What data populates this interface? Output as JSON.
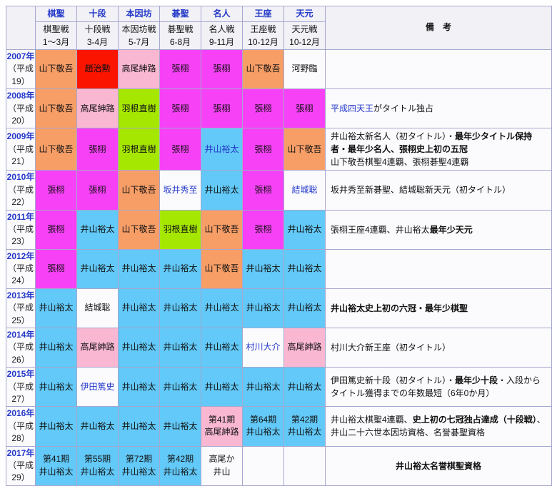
{
  "table": {
    "remarks_header": "備　考",
    "colors": {
      "orange": "#f79e67",
      "red": "#fb1500",
      "pink": "#f9b7d2",
      "magenta": "#f641f6",
      "green": "#a6e702",
      "skyblue": "#62c9f8",
      "plain": "#fbfbfe",
      "header_bg": "#f1f1f6",
      "link_blue": "#2438c8",
      "border": "#a6a7ce"
    },
    "columns": [
      {
        "key": "kisei",
        "label": "棋聖",
        "war": "棋聖戦",
        "months": "1～3月"
      },
      {
        "key": "judan",
        "label": "十段",
        "war": "十段戦",
        "months": "3-4月"
      },
      {
        "key": "honinbo",
        "label": "本因坊",
        "war": "本因坊戦",
        "months": "5-7月"
      },
      {
        "key": "gosei",
        "label": "碁聖",
        "war": "碁聖戦",
        "months": "6-8月"
      },
      {
        "key": "meijin",
        "label": "名人",
        "war": "名人戦",
        "months": "9-11月"
      },
      {
        "key": "oza",
        "label": "王座",
        "war": "王座戦",
        "months": "10-12月"
      },
      {
        "key": "tengen",
        "label": "天元",
        "war": "天元戦",
        "months": "10-12月"
      }
    ],
    "rows": [
      {
        "year": "2007年",
        "era": "（平成19）",
        "cells": [
          {
            "t": "山下敬吾",
            "c": "orange"
          },
          {
            "t": "趙治勲",
            "c": "red"
          },
          {
            "t": "高尾紳路",
            "c": "pink"
          },
          {
            "t": "張栩",
            "c": "magenta"
          },
          {
            "t": "張栩",
            "c": "magenta"
          },
          {
            "t": "山下敬吾",
            "c": "orange"
          },
          {
            "t": "河野臨",
            "c": "plain"
          }
        ],
        "remark": {
          "segments": []
        }
      },
      {
        "year": "2008年",
        "era": "（平成20）",
        "cells": [
          {
            "t": "山下敬吾",
            "c": "orange"
          },
          {
            "t": "高尾紳路",
            "c": "pink"
          },
          {
            "t": "羽根直樹",
            "c": "green"
          },
          {
            "t": "張栩",
            "c": "magenta"
          },
          {
            "t": "張栩",
            "c": "magenta"
          },
          {
            "t": "張栩",
            "c": "magenta"
          },
          {
            "t": "張栩",
            "c": "magenta"
          }
        ],
        "remark": {
          "segments": [
            {
              "t": "平成四天王",
              "link": true
            },
            {
              "t": "がタイトル独占"
            }
          ]
        }
      },
      {
        "year": "2009年",
        "era": "（平成21）",
        "cells": [
          {
            "t": "山下敬吾",
            "c": "orange"
          },
          {
            "t": "張栩",
            "c": "magenta"
          },
          {
            "t": "羽根直樹",
            "c": "green"
          },
          {
            "t": "張栩",
            "c": "magenta"
          },
          {
            "t": "井山裕太",
            "c": "skyblue",
            "link": true
          },
          {
            "t": "張栩",
            "c": "magenta"
          },
          {
            "t": "山下敬吾",
            "c": "orange"
          }
        ],
        "remark": {
          "segments": [
            {
              "t": "井山裕太新名人（初タイトル）・"
            },
            {
              "t": "最年少タイトル保持者・最年少名人、張栩史上初の五冠",
              "b": true
            },
            {
              "br": true
            },
            {
              "t": "山下敬吾棋聖4連覇、張栩碁聖4連覇"
            }
          ]
        }
      },
      {
        "year": "2010年",
        "era": "（平成22）",
        "cells": [
          {
            "t": "張栩",
            "c": "magenta"
          },
          {
            "t": "張栩",
            "c": "magenta"
          },
          {
            "t": "山下敬吾",
            "c": "orange"
          },
          {
            "t": "坂井秀至",
            "c": "plain",
            "link": true
          },
          {
            "t": "井山裕太",
            "c": "skyblue"
          },
          {
            "t": "張栩",
            "c": "magenta"
          },
          {
            "t": "結城聡",
            "c": "plain",
            "link": true
          }
        ],
        "remark": {
          "segments": [
            {
              "t": "坂井秀至新碁聖、結城聡新天元（初タイトル）"
            }
          ]
        }
      },
      {
        "year": "2011年",
        "era": "（平成23）",
        "cells": [
          {
            "t": "張栩",
            "c": "magenta"
          },
          {
            "t": "井山裕太",
            "c": "skyblue"
          },
          {
            "t": "山下敬吾",
            "c": "orange"
          },
          {
            "t": "羽根直樹",
            "c": "green"
          },
          {
            "t": "山下敬吾",
            "c": "orange"
          },
          {
            "t": "張栩",
            "c": "magenta"
          },
          {
            "t": "井山裕太",
            "c": "skyblue"
          }
        ],
        "remark": {
          "segments": [
            {
              "t": "張栩王座4連覇、井山裕太"
            },
            {
              "t": "最年少天元",
              "b": true
            }
          ]
        }
      },
      {
        "year": "2012年",
        "era": "（平成24）",
        "cells": [
          {
            "t": "張栩",
            "c": "magenta"
          },
          {
            "t": "井山裕太",
            "c": "skyblue"
          },
          {
            "t": "井山裕太",
            "c": "skyblue"
          },
          {
            "t": "井山裕太",
            "c": "skyblue"
          },
          {
            "t": "山下敬吾",
            "c": "orange"
          },
          {
            "t": "井山裕太",
            "c": "skyblue"
          },
          {
            "t": "井山裕太",
            "c": "skyblue"
          }
        ],
        "remark": {
          "segments": []
        }
      },
      {
        "year": "2013年",
        "era": "（平成25）",
        "cells": [
          {
            "t": "井山裕太",
            "c": "skyblue"
          },
          {
            "t": "結城聡",
            "c": "plain"
          },
          {
            "t": "井山裕太",
            "c": "skyblue"
          },
          {
            "t": "井山裕太",
            "c": "skyblue"
          },
          {
            "t": "井山裕太",
            "c": "skyblue"
          },
          {
            "t": "井山裕太",
            "c": "skyblue"
          },
          {
            "t": "井山裕太",
            "c": "skyblue"
          }
        ],
        "remark": {
          "segments": [
            {
              "t": "井山裕太史上初の六冠・最年少棋聖",
              "b": true
            }
          ]
        }
      },
      {
        "year": "2014年",
        "era": "（平成26）",
        "cells": [
          {
            "t": "井山裕太",
            "c": "skyblue"
          },
          {
            "t": "高尾紳路",
            "c": "pink"
          },
          {
            "t": "井山裕太",
            "c": "skyblue"
          },
          {
            "t": "井山裕太",
            "c": "skyblue"
          },
          {
            "t": "井山裕太",
            "c": "skyblue"
          },
          {
            "t": "村川大介",
            "c": "plain",
            "link": true
          },
          {
            "t": "高尾紳路",
            "c": "pink"
          }
        ],
        "remark": {
          "segments": [
            {
              "t": "村川大介新王座（初タイトル）"
            }
          ]
        }
      },
      {
        "year": "2015年",
        "era": "（平成27）",
        "cells": [
          {
            "t": "井山裕太",
            "c": "skyblue"
          },
          {
            "t": "伊田篤史",
            "c": "plain",
            "link": true
          },
          {
            "t": "井山裕太",
            "c": "skyblue"
          },
          {
            "t": "井山裕太",
            "c": "skyblue"
          },
          {
            "t": "井山裕太",
            "c": "skyblue"
          },
          {
            "t": "井山裕太",
            "c": "skyblue"
          },
          {
            "t": "井山裕太",
            "c": "skyblue"
          }
        ],
        "remark": {
          "segments": [
            {
              "t": "伊田篤史新十段（初タイトル）・"
            },
            {
              "t": "最年少十段",
              "b": true
            },
            {
              "t": "・入段からタイトル獲得までの年数最短（6年0か月）"
            }
          ]
        }
      },
      {
        "year": "2016年",
        "era": "（平成28）",
        "cells": [
          {
            "t": "井山裕太",
            "c": "skyblue"
          },
          {
            "t": "井山裕太",
            "c": "skyblue"
          },
          {
            "t": "井山裕太",
            "c": "skyblue"
          },
          {
            "t": "井山裕太",
            "c": "skyblue"
          },
          {
            "t": "第41期\n高尾紳路",
            "c": "pink"
          },
          {
            "t": "第64期\n井山裕太",
            "c": "skyblue"
          },
          {
            "t": "第42期\n井山裕太",
            "c": "skyblue"
          }
        ],
        "remark": {
          "segments": [
            {
              "t": "井山裕太棋聖4連覇、"
            },
            {
              "t": "史上初の七冠独占達成（十段戦）",
              "b": true
            },
            {
              "t": "、井山二十六世本因坊資格、名誉碁聖資格"
            }
          ]
        }
      },
      {
        "year": "2017年",
        "era": "（平成29）",
        "cells": [
          {
            "t": "第41期\n井山裕太",
            "c": "skyblue"
          },
          {
            "t": "第55期\n井山裕太",
            "c": "skyblue"
          },
          {
            "t": "第72期\n井山裕太",
            "c": "skyblue"
          },
          {
            "t": "第42期\n井山裕太",
            "c": "skyblue"
          },
          {
            "t": "高尾か\n井山",
            "c": "plain"
          },
          {
            "t": "",
            "c": "plain"
          },
          {
            "t": "",
            "c": "plain"
          }
        ],
        "remark": {
          "segments": [
            {
              "t": "井山裕太名誉棋聖資格",
              "b": true
            }
          ],
          "center": true
        }
      }
    ]
  }
}
